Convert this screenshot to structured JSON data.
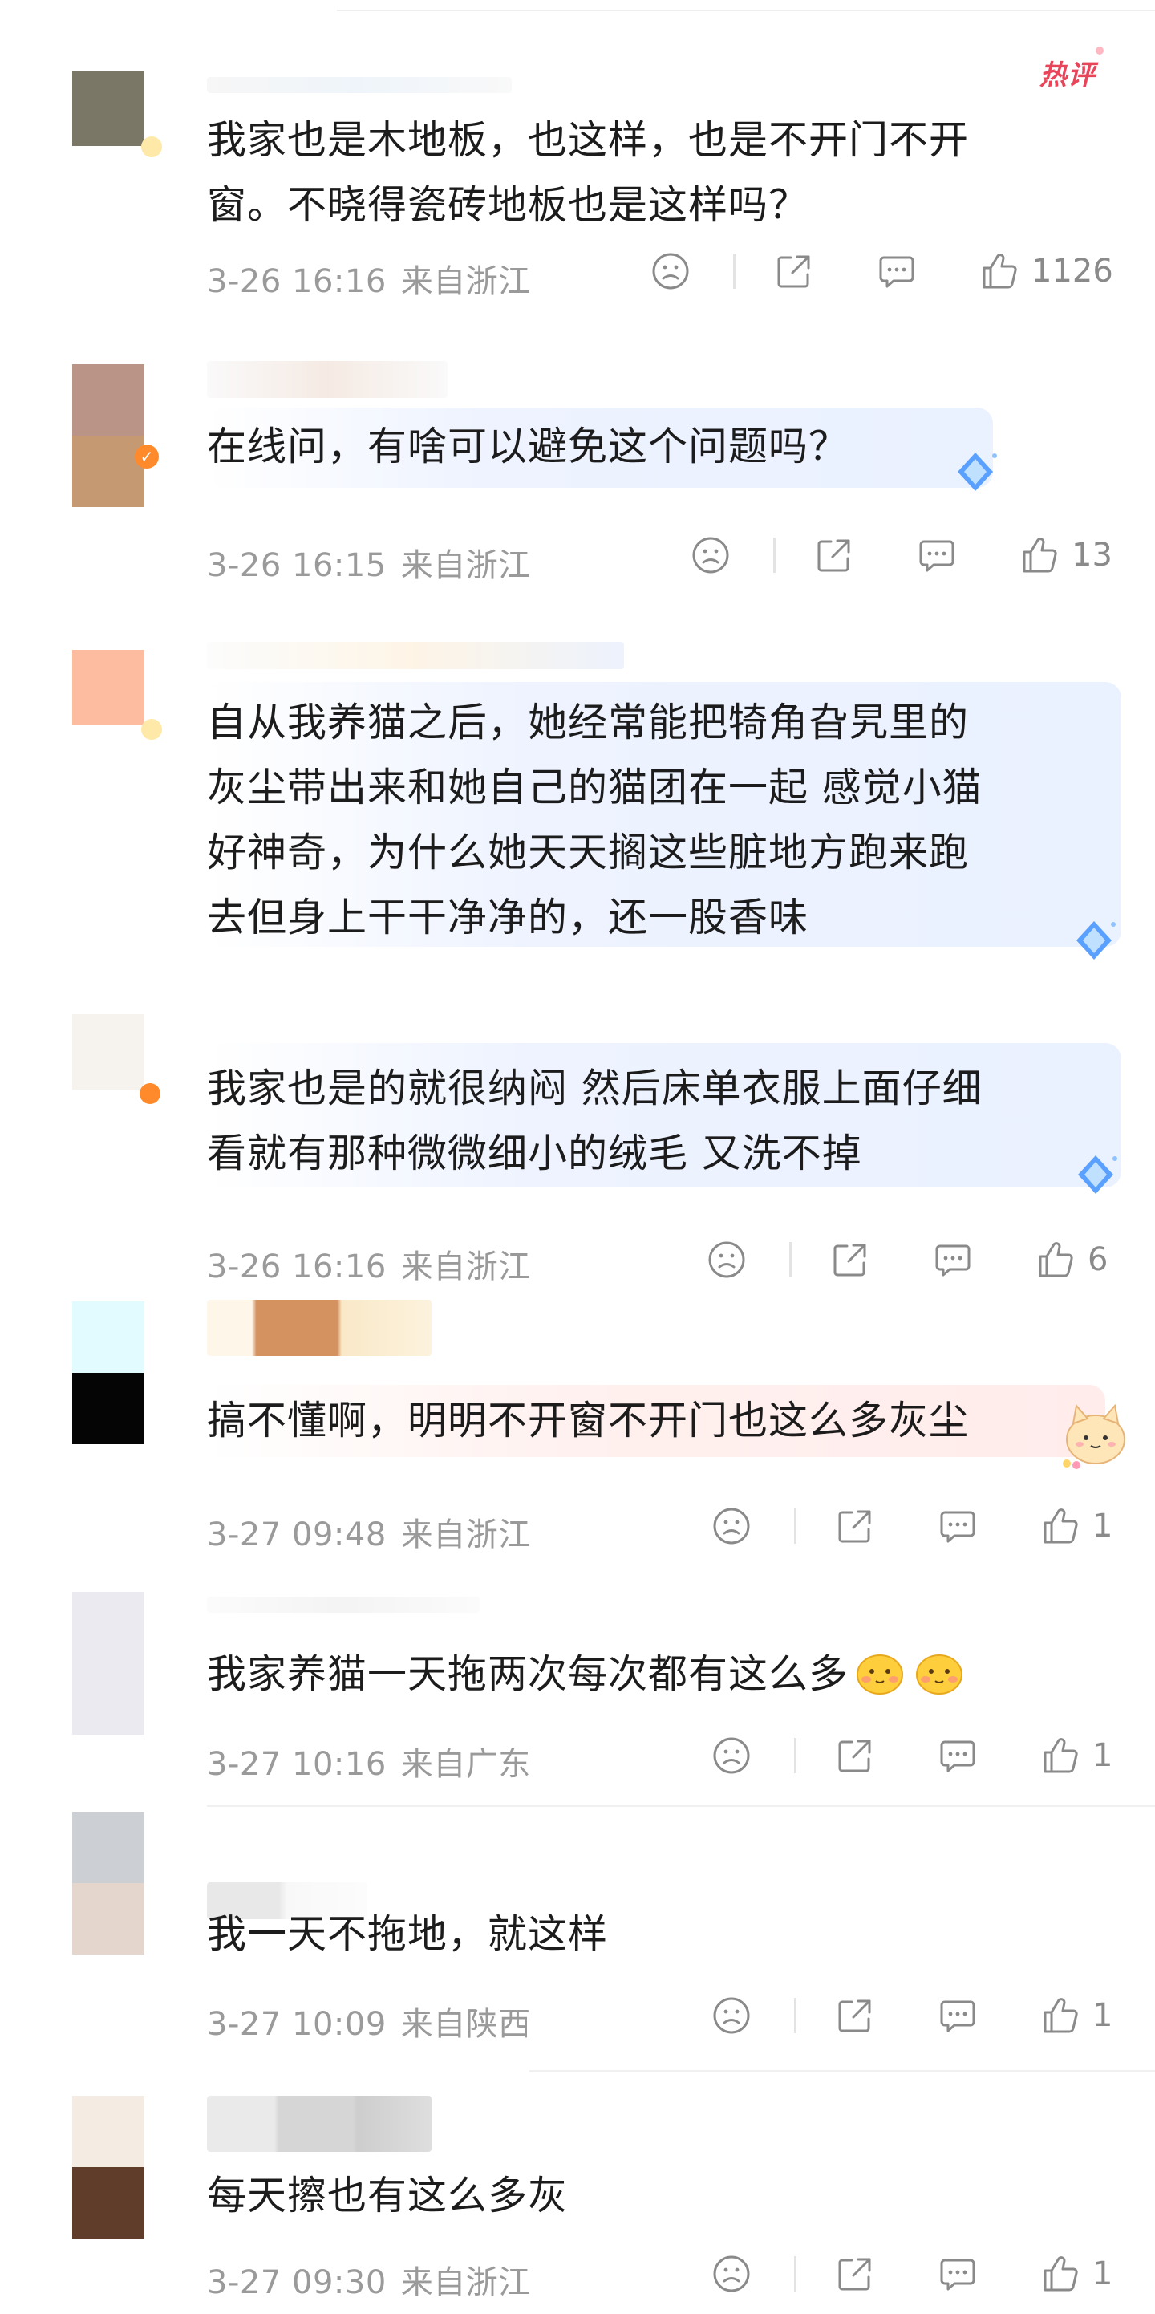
{
  "hot_badge": "热评",
  "colors": {
    "accent": "#e8455a",
    "meta_gray": "#9a9a9a",
    "icon_gray": "#8a8a8a"
  },
  "comments": [
    {
      "text": [
        "我家也是木地板，也这样，也是不开门不开",
        "窗。不晓得瓷砖地板也是这样吗？"
      ],
      "date": "3-26 16:16",
      "location": "来自浙江",
      "likes": "1126"
    },
    {
      "text": [
        "在线问，有啥可以避免这个问题吗？"
      ],
      "date": "3-26 16:15",
      "location": "来自浙江",
      "likes": "13"
    },
    {
      "text": [
        "自从我养猫之后，她经常能把犄角旮旯里的",
        "灰尘带出来和她自己的猫团在一起 感觉小猫",
        "好神奇，为什么她天天搁这些脏地方跑来跑",
        "去但身上干干净净的，还一股香味"
      ]
    },
    {
      "text": [
        "我家也是的就很纳闷 然后床单衣服上面仔细",
        "看就有那种微微细小的绒毛 又洗不掉"
      ],
      "date": "3-26 16:16",
      "location": "来自浙江",
      "likes": "6"
    },
    {
      "text": [
        "搞不懂啊，明明不开窗不开门也这么多灰尘"
      ],
      "date": "3-27 09:48",
      "location": "来自浙江",
      "likes": "1"
    },
    {
      "text": [
        "我家养猫一天拖两次每次都有这么多"
      ],
      "date": "3-27 10:16",
      "location": "来自广东",
      "likes": "1"
    },
    {
      "text": [
        "我一天不拖地，就这样"
      ],
      "date": "3-27 10:09",
      "location": "来自陕西",
      "likes": "1"
    },
    {
      "text": [
        "每天擦也有这么多灰"
      ],
      "date": "3-27 09:30",
      "location": "来自浙江",
      "likes": "1"
    }
  ],
  "icons": [
    "dislike-icon",
    "share-icon",
    "reply-icon",
    "like-icon",
    "diamond-icon",
    "cat-sticker",
    "blush-emoji"
  ]
}
